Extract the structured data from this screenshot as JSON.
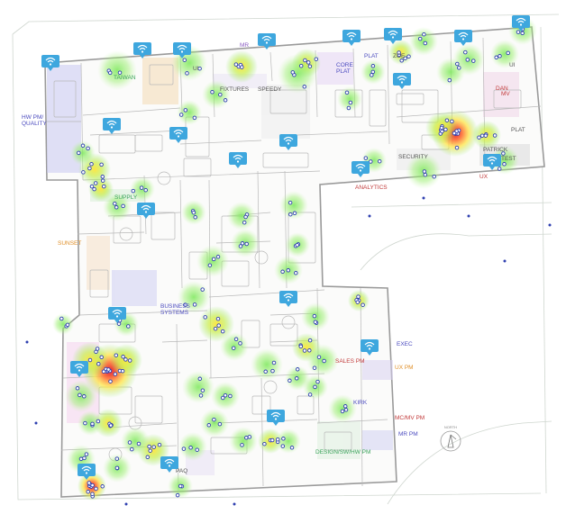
{
  "map": {
    "type": "wifi-heatmap-floorplan",
    "colors": {
      "background": "#ffffff",
      "wall": "#b9b9b9",
      "wall_dark": "#8d8d8d",
      "heat_low": "#7be85a",
      "heat_mid": "#ffe53b",
      "heat_high": "#ff6a2a",
      "heat_max": "#e0142a",
      "ap_marker": "#3ea7de",
      "client_dot": "#2e3fb0"
    },
    "icons": {
      "access_point": "wifi-access-point-icon",
      "north_arrow": "north-arrow-icon"
    }
  },
  "labels": {
    "hw_pm_quality": "HW PM/\nQUALITY",
    "taiwan": "TAIWAN",
    "ui_top": "UI",
    "mr": "MR",
    "fixtures": "FIXTURES",
    "speedy": "SPEEDY",
    "core_plat": "CORE\nPLAT",
    "plat": "PLAT",
    "zoe": "ZOE",
    "ui_right": "UI",
    "dan": "DAN",
    "mv": "MV",
    "plat_right": "PLAT",
    "security": "SECURITY",
    "patrick": "PATRICK",
    "test": "TEST",
    "ux": "UX",
    "analytics": "ANALYTICS",
    "supply": "SUPPLY",
    "sunset": "SUNSET",
    "business_systems": "BUSINESS\nSYSTEMS",
    "exec": "EXEC",
    "sales_pm": "SALES PM",
    "ux_pm": "UX PM",
    "mc_mv_pm": "MC/MV PM",
    "mr_pm": "MR PM",
    "design_sw_pm": "DESIGN/SW/HW PM",
    "kirk": "KIRK",
    "paq": "PAQ",
    "north": "NORTH"
  }
}
